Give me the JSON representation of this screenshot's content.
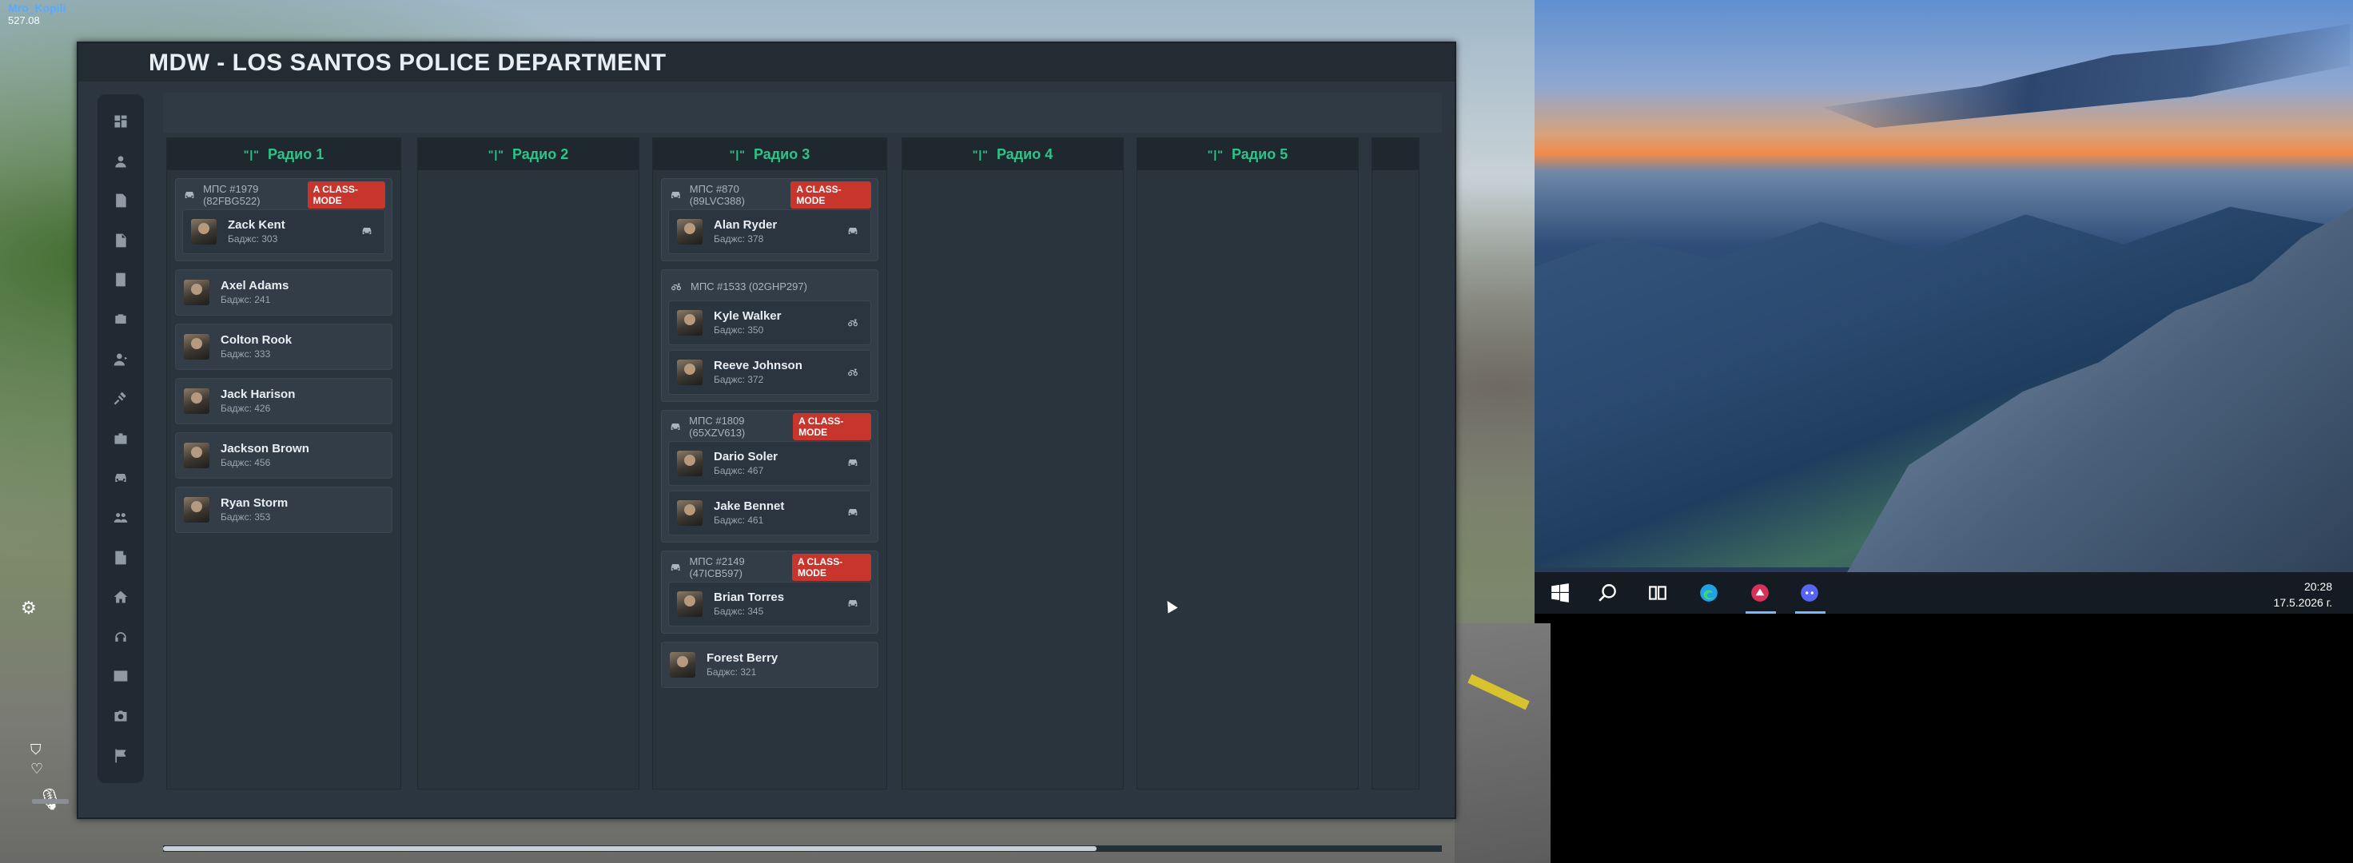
{
  "hud": {
    "player_tag": "Mro_Kopili",
    "money": "527.08"
  },
  "mdw": {
    "title": "MDW - LOS SANTOS POLICE DEPARTMENT",
    "sidebar_icons": [
      "dashboard-icon",
      "person-icon",
      "report-icon",
      "document-icon",
      "list-icon",
      "evidence-icon",
      "officer-icon",
      "gavel-icon",
      "briefcase-icon",
      "car-icon",
      "users-icon",
      "building-icon",
      "home-icon",
      "headset-icon",
      "image-icon",
      "camera-icon",
      "flag-icon"
    ],
    "columns": [
      {
        "label": "Радио 1",
        "items": [
          {
            "type": "vehicle",
            "vehicle": "МПС #1979 (82FBG522)",
            "badge": "A CLASS-MODE",
            "members": [
              {
                "name": "Zack Kent",
                "badge": "Баджс: 303"
              }
            ]
          },
          {
            "type": "member",
            "name": "Axel Adams",
            "badge": "Баджс: 241"
          },
          {
            "type": "member",
            "name": "Colton Rook",
            "badge": "Баджс: 333"
          },
          {
            "type": "member",
            "name": "Jack Harison",
            "badge": "Баджс: 426"
          },
          {
            "type": "member",
            "name": "Jackson Brown",
            "badge": "Баджс: 456"
          },
          {
            "type": "member",
            "name": "Ryan Storm",
            "badge": "Баджс: 353"
          }
        ]
      },
      {
        "label": "Радио 2",
        "items": []
      },
      {
        "label": "Радио 3",
        "items": [
          {
            "type": "vehicle",
            "vehicle": "МПС #870 (89LVC388)",
            "badge": "A CLASS-MODE",
            "members": [
              {
                "name": "Alan Ryder",
                "badge": "Баджс: 378"
              }
            ]
          },
          {
            "type": "vehicle",
            "vehicle": "МПС #1533 (02GHP297)",
            "badge": "",
            "moto": true,
            "members": [
              {
                "name": "Kyle Walker",
                "badge": "Баджс: 350"
              },
              {
                "name": "Reeve Johnson",
                "badge": "Баджс: 372"
              }
            ]
          },
          {
            "type": "vehicle",
            "vehicle": "МПС #1809 (65XZV613)",
            "badge": "A CLASS-MODE",
            "members": [
              {
                "name": "Dario Soler",
                "badge": "Баджс: 467"
              },
              {
                "name": "Jake Bennet",
                "badge": "Баджс: 461"
              }
            ]
          },
          {
            "type": "vehicle",
            "vehicle": "МПС #2149 (47ICB597)",
            "badge": "A CLASS-MODE",
            "members": [
              {
                "name": "Brian Torres",
                "badge": "Баджс: 345"
              }
            ]
          },
          {
            "type": "member",
            "name": "Forest Berry",
            "badge": "Баджс: 321"
          }
        ]
      },
      {
        "label": "Радио 4",
        "items": []
      },
      {
        "label": "Радио 5",
        "items": []
      }
    ]
  },
  "taskbar": {
    "time": "20:28",
    "date": "17.5.2026 г."
  },
  "colors": {
    "accent_green": "#2bc48a",
    "class_badge_red": "#c8352d",
    "panel_dark": "#2c3640"
  }
}
